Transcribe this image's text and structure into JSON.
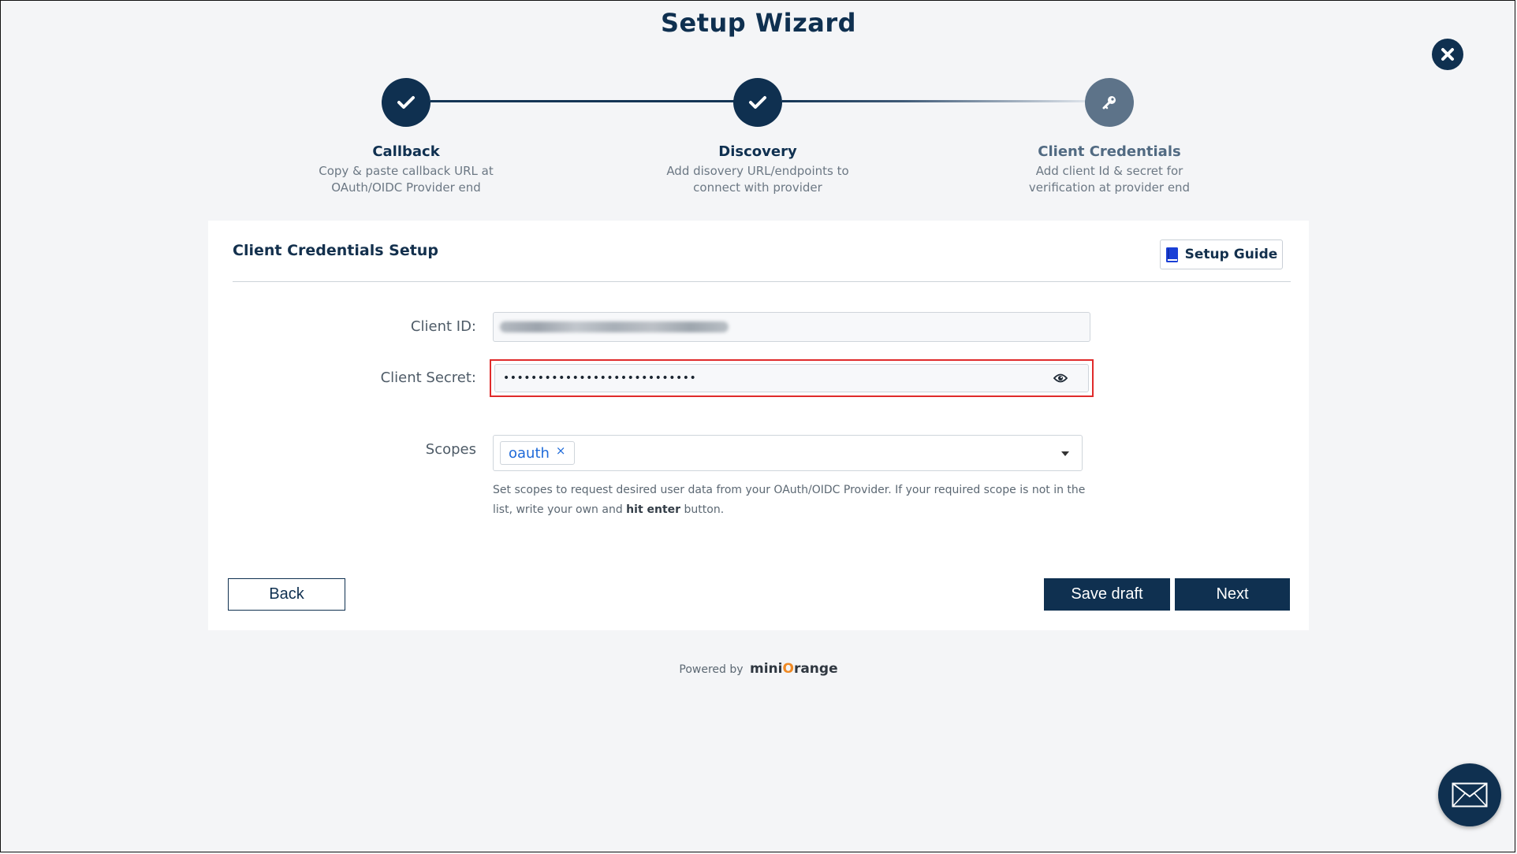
{
  "wizard": {
    "title": "Setup Wizard",
    "close_icon": "close-icon",
    "steps": [
      {
        "label": "Callback",
        "desc_line1": "Copy & paste callback URL at",
        "desc_line2": "OAuth/OIDC Provider end",
        "state": "done",
        "icon": "check-icon"
      },
      {
        "label": "Discovery",
        "desc_line1": "Add disovery URL/endpoints to",
        "desc_line2": "connect with provider",
        "state": "done",
        "icon": "check-icon"
      },
      {
        "label": "Client Credentials",
        "desc_line1": "Add client Id & secret for",
        "desc_line2": "verification at provider end",
        "state": "active",
        "icon": "key-icon"
      }
    ]
  },
  "card": {
    "title": "Client Credentials Setup",
    "guide_label": "Setup Guide",
    "guide_icon": "book-icon"
  },
  "form": {
    "client_id_label": "Client ID:",
    "client_secret_label": "Client Secret:",
    "client_secret_masked": "••••••••••••••••••••••••••••",
    "secret_toggle_icon": "eye-icon",
    "scopes_label": "Scopes",
    "scope_tags": [
      "oauth"
    ],
    "scope_remove_glyph": "×",
    "help_text_1": "Set scopes to request desired user data from your OAuth/OIDC Provider. If your required scope is not in the list, write your own and ",
    "help_text_bold": "hit enter",
    "help_text_2": " button."
  },
  "actions": {
    "back_label": "Back",
    "save_draft_label": "Save draft",
    "next_label": "Next"
  },
  "footer": {
    "powered_by": "Powered by",
    "brand_prefix": "mini",
    "brand_o": "O",
    "brand_suffix": "range"
  },
  "colors": {
    "primary": "#0f3050",
    "active_step": "#5d7389",
    "highlight_border": "#e02b2b",
    "tag_text": "#1e6ad9"
  }
}
